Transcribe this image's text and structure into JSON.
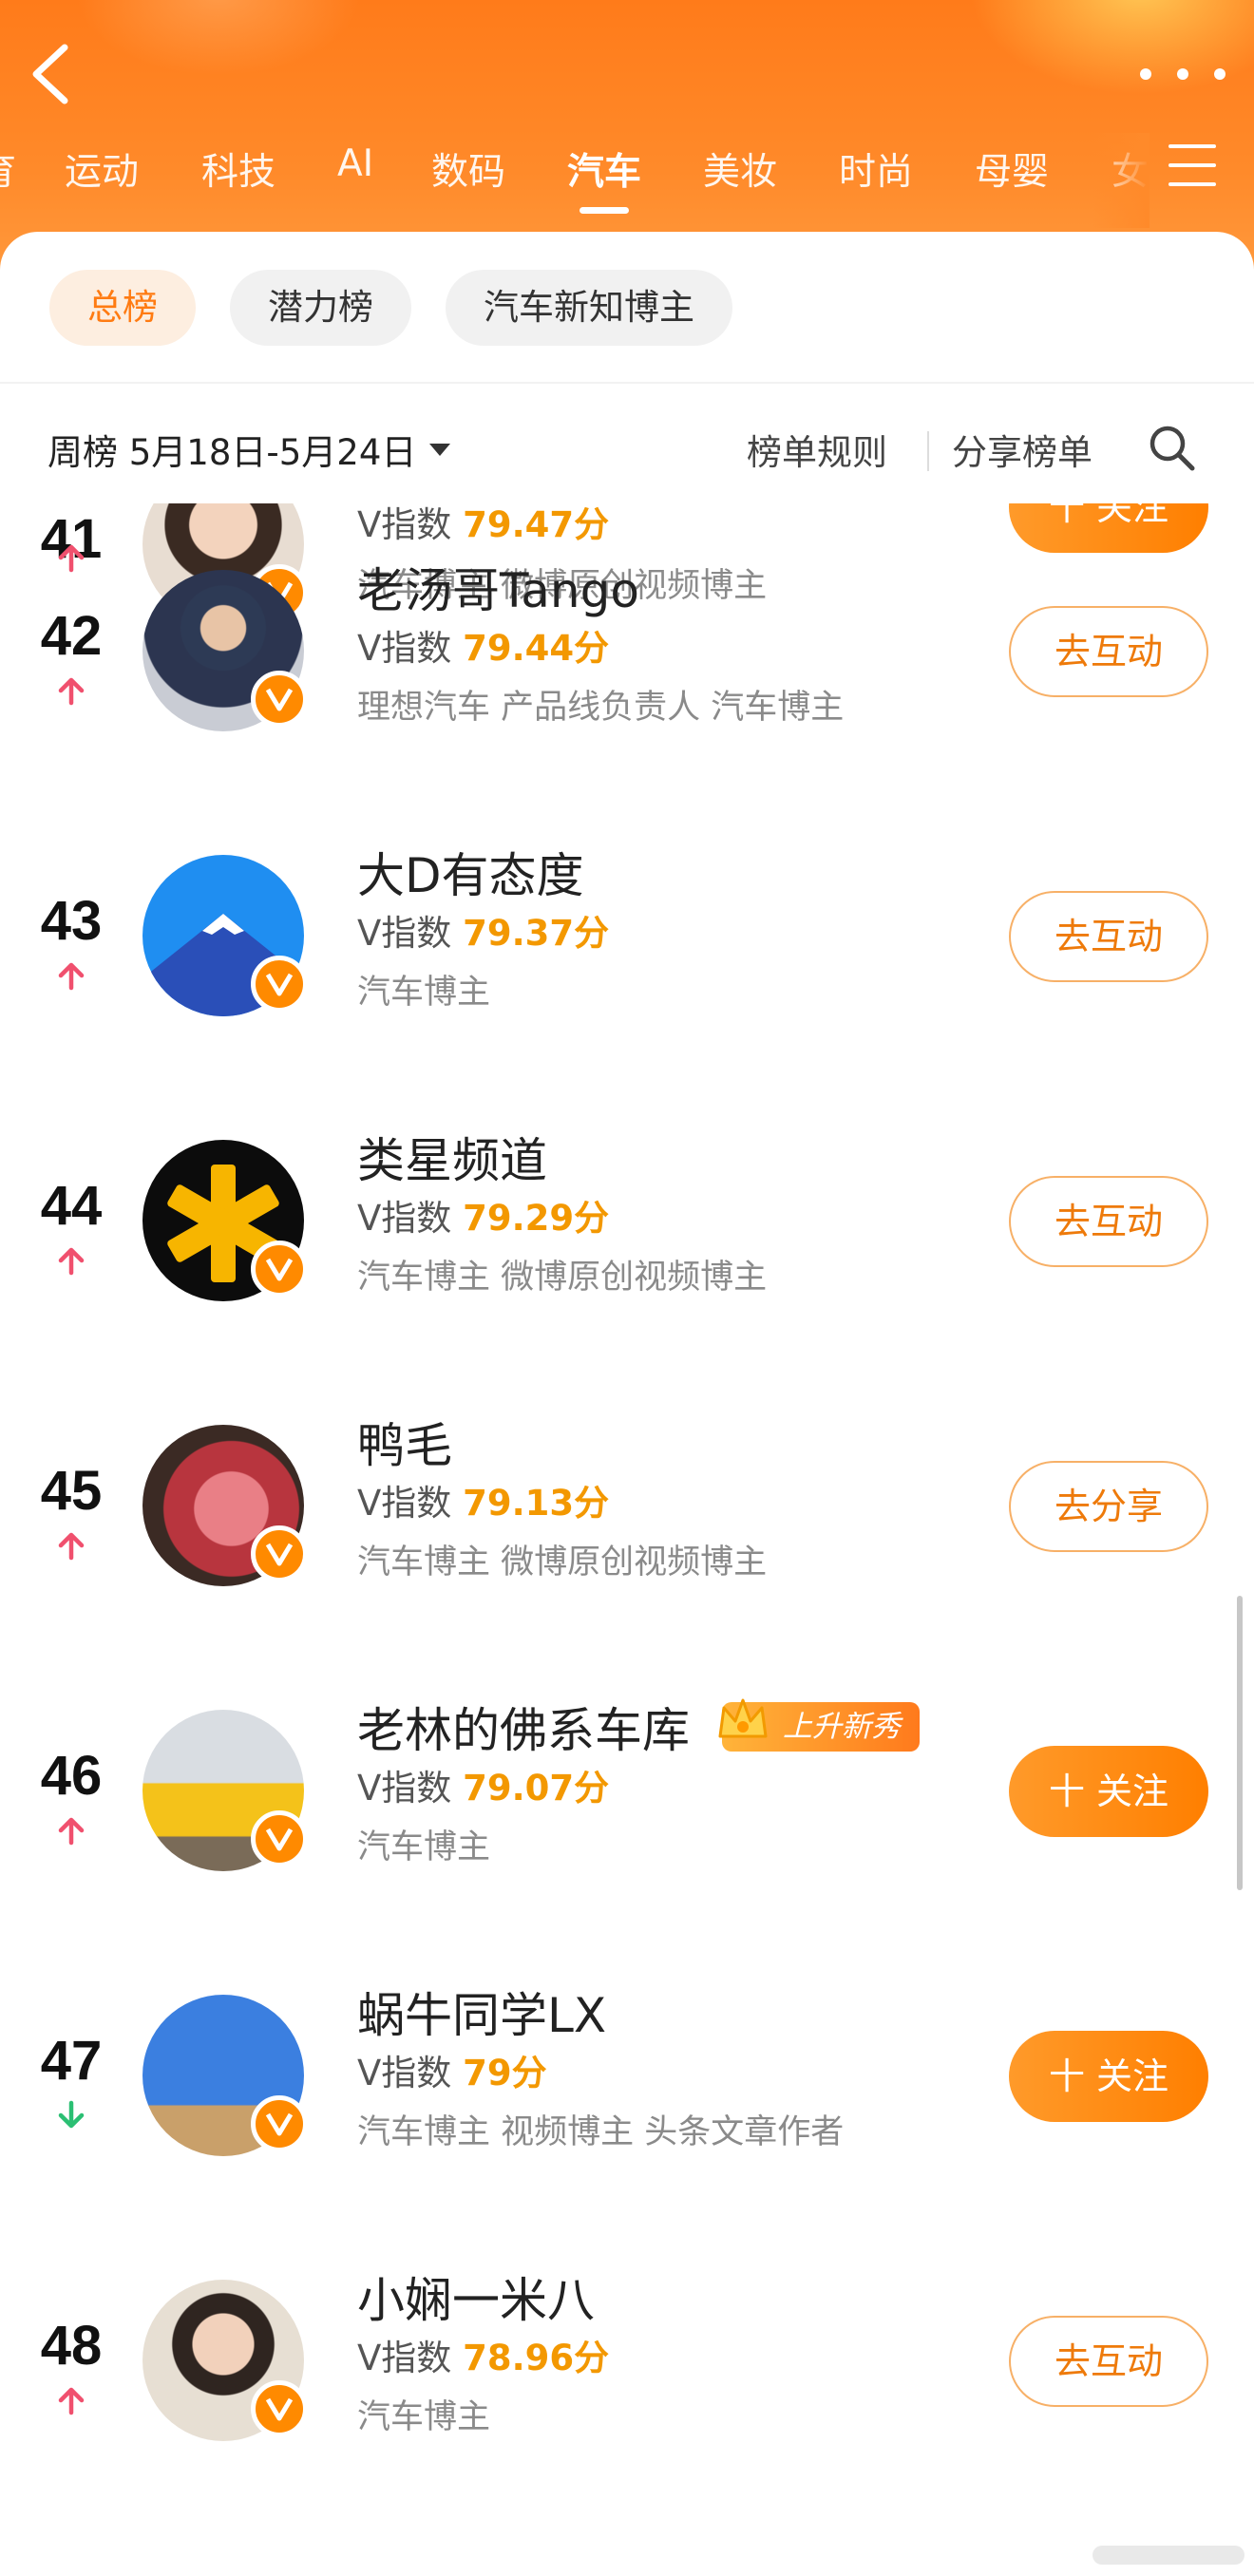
{
  "header": {
    "tabs": [
      {
        "label": "育",
        "active": false
      },
      {
        "label": "运动",
        "active": false
      },
      {
        "label": "科技",
        "active": false
      },
      {
        "label": "AI",
        "active": false
      },
      {
        "label": "数码",
        "active": false
      },
      {
        "label": "汽车",
        "active": true
      },
      {
        "label": "美妆",
        "active": false
      },
      {
        "label": "时尚",
        "active": false
      },
      {
        "label": "母婴",
        "active": false
      },
      {
        "label": "女",
        "active": false
      }
    ]
  },
  "boards": {
    "items": [
      {
        "label": "总榜",
        "active": true
      },
      {
        "label": "潜力榜",
        "active": false
      },
      {
        "label": "汽车新知博主",
        "active": false
      }
    ]
  },
  "filter": {
    "period": "周榜 5月18日-5月24日",
    "rules": "榜单规则",
    "share": "分享榜单"
  },
  "list": {
    "score_prefix": "V指数",
    "rows": [
      {
        "rank": "41",
        "trend": "up",
        "name": "",
        "score": "79.47分",
        "tags": "汽车博主 微博原创视频博主",
        "action": "十 关注",
        "action_style": "fill"
      },
      {
        "rank": "42",
        "trend": "up",
        "name": "老汤哥Tango",
        "score": "79.44分",
        "tags": "理想汽车 产品线负责人 汽车博主",
        "action": "去互动",
        "action_style": "outline"
      },
      {
        "rank": "43",
        "trend": "up",
        "name": "大D有态度",
        "score": "79.37分",
        "tags": "汽车博主",
        "action": "去互动",
        "action_style": "outline"
      },
      {
        "rank": "44",
        "trend": "up",
        "name": "类星频道",
        "score": "79.29分",
        "tags": "汽车博主 微博原创视频博主",
        "action": "去互动",
        "action_style": "outline"
      },
      {
        "rank": "45",
        "trend": "up",
        "name": "鸭毛",
        "score": "79.13分",
        "tags": "汽车博主 微博原创视频博主",
        "action": "去分享",
        "action_style": "outline"
      },
      {
        "rank": "46",
        "trend": "up",
        "name": "老林的佛系车库",
        "score": "79.07分",
        "tags": "汽车博主",
        "action": "十 关注",
        "action_style": "fill",
        "badge": "上升新秀"
      },
      {
        "rank": "47",
        "trend": "down",
        "name": "蜗牛同学LX",
        "score": "79分",
        "tags": "汽车博主 视频博主 头条文章作者",
        "action": "十 关注",
        "action_style": "fill"
      },
      {
        "rank": "48",
        "trend": "up",
        "name": "小娴一米八",
        "score": "78.96分",
        "tags": "汽车博主",
        "action": "去互动",
        "action_style": "outline"
      }
    ]
  },
  "colors": {
    "brand_orange": "#ff7b12",
    "score_orange": "#f39800",
    "trend_up": "#f0506e",
    "trend_down": "#2bbf73",
    "verified_badge": "#ff8a00"
  },
  "icons": [
    "back-icon",
    "more-icon",
    "menu-icon",
    "search-icon",
    "caret-down-icon",
    "trend-up-icon",
    "trend-down-icon",
    "verified-v-icon",
    "crown-icon"
  ]
}
